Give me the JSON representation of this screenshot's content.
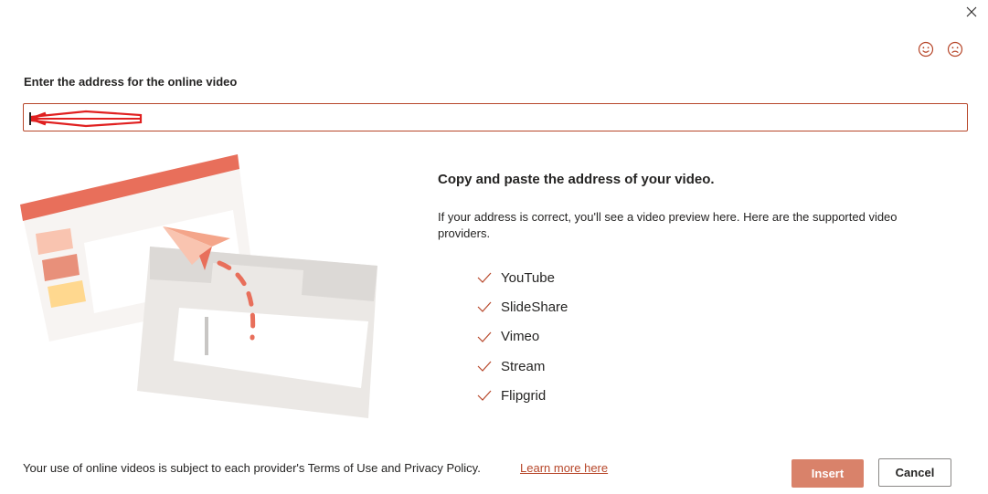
{
  "dialog": {
    "close_icon": "close-icon",
    "feedback_positive_icon": "smile-icon",
    "feedback_negative_icon": "frown-icon"
  },
  "address": {
    "label": "Enter the address for the online video",
    "value": "",
    "annotation": "red-arrow-annotation"
  },
  "info": {
    "title": "Copy and paste the address of your video.",
    "description": "If your address is correct, you'll see a video preview here. Here are the supported video providers.",
    "providers": [
      "YouTube",
      "SlideShare",
      "Vimeo",
      "Stream",
      "Flipgrid"
    ]
  },
  "footer": {
    "terms_text": "Your use of online videos is subject to each provider's Terms of Use and Privacy Policy.",
    "learn_more_label": "Learn more here",
    "insert_label": "Insert",
    "cancel_label": "Cancel"
  },
  "colors": {
    "accent": "#b7472a",
    "insert_button": "#d9826a",
    "illustration_primary": "#e86f5b"
  }
}
